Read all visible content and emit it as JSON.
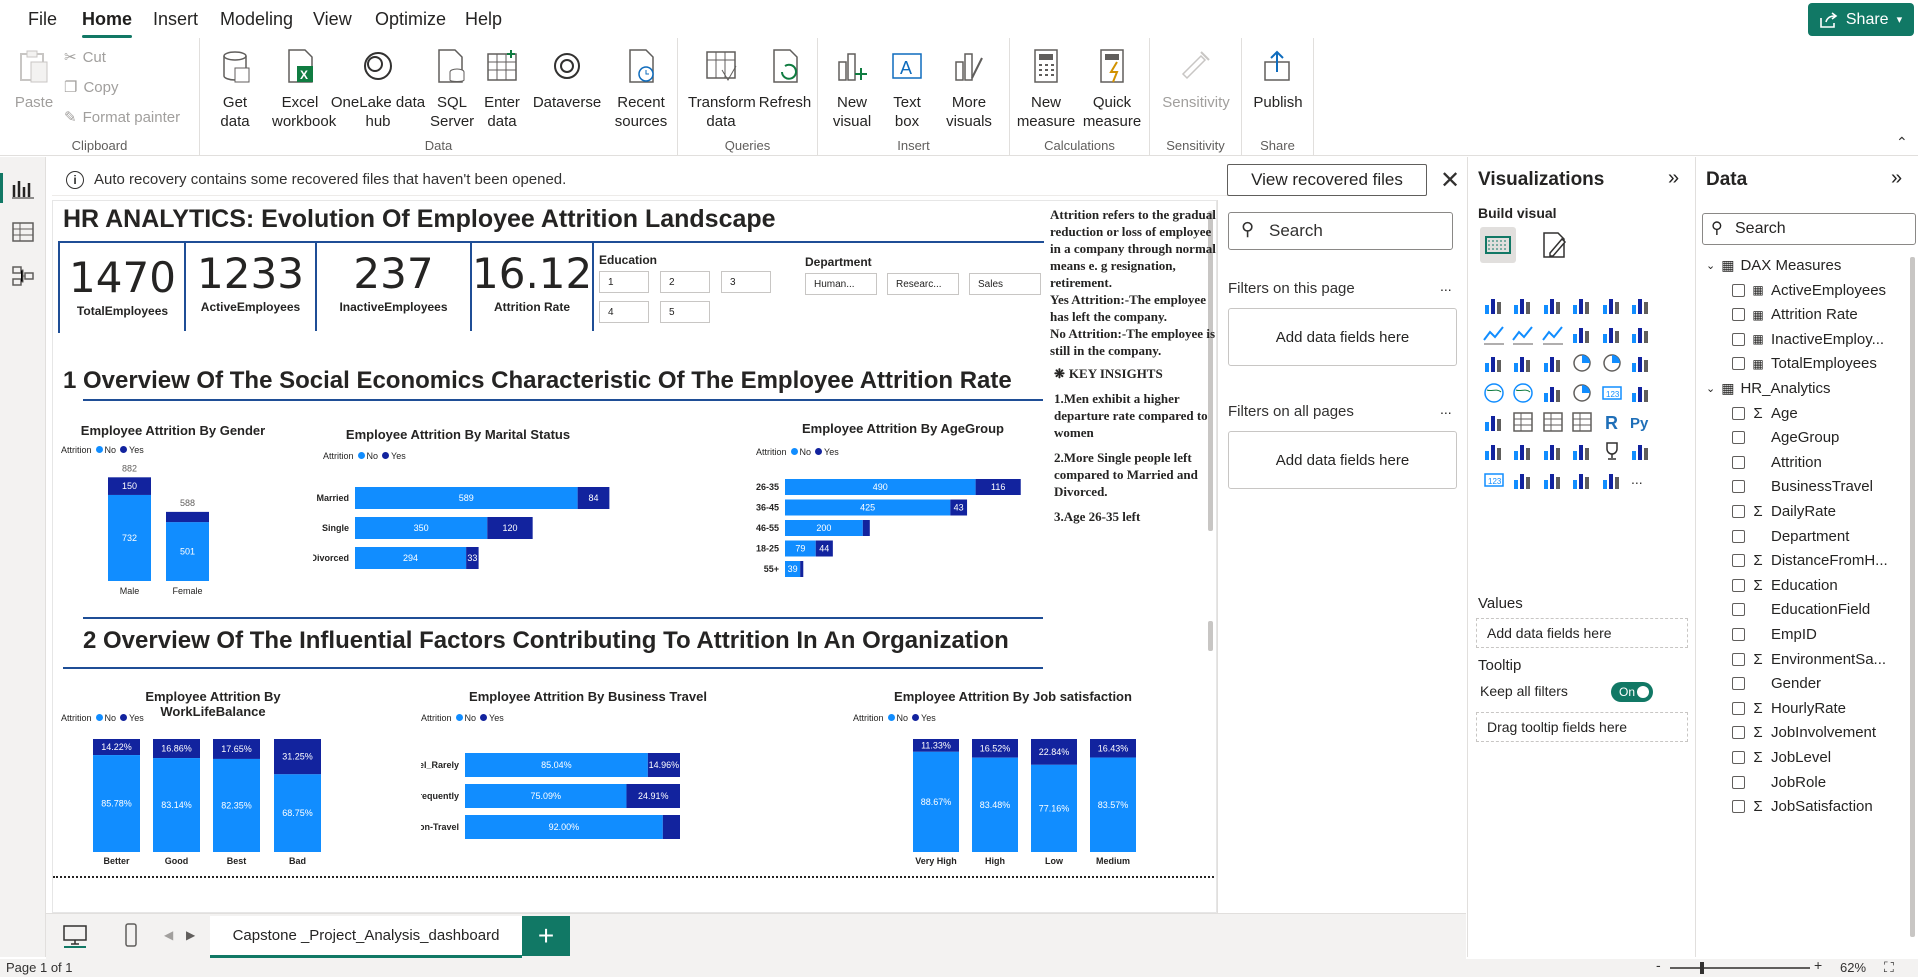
{
  "menu": {
    "file": "File",
    "home": "Home",
    "insert": "Insert",
    "modeling": "Modeling",
    "view": "View",
    "optimize": "Optimize",
    "help": "Help",
    "share": "Share"
  },
  "ribbon": {
    "clipboard": {
      "paste": "Paste",
      "cut": "Cut",
      "copy": "Copy",
      "format_painter": "Format painter",
      "label": "Clipboard"
    },
    "data": {
      "get_data": "Get data",
      "excel": "Excel workbook",
      "onelake": "OneLake data hub",
      "sql": "SQL Server",
      "enter": "Enter data",
      "dataverse": "Dataverse",
      "recent": "Recent sources",
      "label": "Data"
    },
    "queries": {
      "transform": "Transform data",
      "refresh": "Refresh",
      "label": "Queries"
    },
    "insert": {
      "new_visual": "New visual",
      "text_box": "Text box",
      "more_visuals": "More visuals",
      "label": "Insert"
    },
    "calculations": {
      "new_measure": "New measure",
      "quick_measure": "Quick measure",
      "label": "Calculations"
    },
    "sensitivity": {
      "sensitivity": "Sensitivity",
      "label": "Sensitivity"
    },
    "share": {
      "publish": "Publish",
      "label": "Share"
    }
  },
  "notice": {
    "text": "Auto recovery contains some recovered files that haven't been opened.",
    "button": "View recovered files"
  },
  "report": {
    "title": "HR ANALYTICS: Evolution Of Employee Attrition Landscape",
    "kpis": [
      {
        "value": "1470",
        "label": "TotalEmployees"
      },
      {
        "value": "1233",
        "label": "ActiveEmployees"
      },
      {
        "value": "237",
        "label": "InactiveEmployees"
      },
      {
        "value": "16.12",
        "label": "Attrition Rate"
      }
    ],
    "education": {
      "label": "Education",
      "options": [
        "1",
        "2",
        "3",
        "4",
        "5"
      ]
    },
    "department": {
      "label": "Department",
      "options": [
        "Human...",
        "Researc...",
        "Sales"
      ]
    },
    "section1": "1 Overview Of The Social Economics Characteristic Of The Employee Attrition Rate",
    "section2": "2 Overview Of The Influential Factors Contributing To Attrition In An Organization",
    "legend": {
      "title": "Attrition",
      "no": "No",
      "yes": "Yes"
    },
    "side_text": {
      "definition": "Attrition refers to the gradual reduction or loss of employee in a company through normal means e. g resignation, retirement.",
      "yes": "Yes Attrition:-The employee has left the company.",
      "no": "No Attrition:-The employee is still in the company.",
      "insights_title": "KEY INSIGHTS",
      "insight1": "1.Men exhibit a higher departure rate compared to women",
      "insight2": "2.More Single people left compared to Married and Divorced.",
      "insight3": "3.Age 26-35 left"
    }
  },
  "chart_data": [
    {
      "id": "gender",
      "type": "bar",
      "title": "Employee Attrition By Gender",
      "categories": [
        "Male",
        "Female"
      ],
      "series": [
        {
          "name": "No",
          "values": [
            732,
            501
          ]
        },
        {
          "name": "Yes",
          "values": [
            150,
            87
          ]
        }
      ],
      "labels": {
        "no": [
          "732",
          "501"
        ],
        "yes": [
          "150",
          ""
        ]
      },
      "totals": [
        "882",
        "588"
      ],
      "colors": {
        "no": "#118dff",
        "yes": "#12239e"
      }
    },
    {
      "id": "marital",
      "type": "bar",
      "title": "Employee Attrition By Marital Status",
      "categories": [
        "Married",
        "Single",
        "Divorced"
      ],
      "series": [
        {
          "name": "No",
          "values": [
            589,
            350,
            294
          ]
        },
        {
          "name": "Yes",
          "values": [
            84,
            120,
            33
          ]
        }
      ],
      "labels": {
        "no": [
          "589",
          "350",
          "294"
        ],
        "yes": [
          "84",
          "120",
          "33"
        ]
      }
    },
    {
      "id": "age",
      "type": "bar",
      "title": "Employee Attrition By AgeGroup",
      "categories": [
        "26-35",
        "36-45",
        "46-55",
        "18-25",
        "55+"
      ],
      "series": [
        {
          "name": "No",
          "values": [
            490,
            425,
            200,
            79,
            39
          ]
        },
        {
          "name": "Yes",
          "values": [
            116,
            43,
            18,
            44,
            8
          ]
        }
      ],
      "labels": {
        "no": [
          "490",
          "425",
          "200",
          "79",
          "39"
        ],
        "yes": [
          "116",
          "43",
          "",
          "44",
          ""
        ]
      }
    },
    {
      "id": "wlb",
      "type": "bar",
      "title": "Employee Attrition By WorkLifeBalance",
      "categories": [
        "Better",
        "Good",
        "Best",
        "Bad"
      ],
      "series": [
        {
          "name": "No",
          "values": [
            85.78,
            83.14,
            82.35,
            68.75
          ]
        },
        {
          "name": "Yes",
          "values": [
            14.22,
            16.86,
            17.65,
            31.25
          ]
        }
      ],
      "labels": {
        "no": [
          "85.78%",
          "83.14%",
          "82.35%",
          "68.75%"
        ],
        "yes": [
          "14.22%",
          "16.86%",
          "17.65%",
          "31.25%"
        ]
      }
    },
    {
      "id": "travel",
      "type": "bar",
      "title": "Employee Attrition By Business Travel",
      "categories": [
        "Travel_Rarely",
        "Travel_Frequently",
        "Non-Travel"
      ],
      "series": [
        {
          "name": "No",
          "values": [
            85.04,
            75.09,
            92.0
          ]
        },
        {
          "name": "Yes",
          "values": [
            14.96,
            24.91,
            8.0
          ]
        }
      ],
      "labels": {
        "no": [
          "85.04%",
          "75.09%",
          "92.00%"
        ],
        "yes": [
          "14.96%",
          "24.91%",
          ""
        ]
      }
    },
    {
      "id": "jobsat",
      "type": "bar",
      "title": "Employee Attrition By Job satisfaction",
      "categories": [
        "Very High",
        "High",
        "Low",
        "Medium"
      ],
      "series": [
        {
          "name": "No",
          "values": [
            88.67,
            83.48,
            77.16,
            83.57
          ]
        },
        {
          "name": "Yes",
          "values": [
            11.33,
            16.52,
            22.84,
            16.43
          ]
        }
      ],
      "labels": {
        "no": [
          "88.67%",
          "83.48%",
          "77.16%",
          "83.57%"
        ],
        "yes": [
          "11.33%",
          "16.52%",
          "22.84%",
          "16.43%"
        ]
      }
    }
  ],
  "filters": {
    "search": "Search",
    "on_page": "Filters on this page",
    "all_pages": "Filters on all pages",
    "add": "Add data fields here",
    "more": "..."
  },
  "visualizations": {
    "title": "Visualizations",
    "build": "Build visual",
    "values": "Values",
    "values_add": "Add data fields here",
    "tooltip": "Tooltip",
    "keep_filters": "Keep all filters",
    "toggle": "On",
    "tooltip_add": "Drag tooltip fields here",
    "r": "R",
    "py": "Py",
    "more": "..."
  },
  "data_pane": {
    "title": "Data",
    "search": "Search",
    "groups": [
      {
        "name": "DAX Measures",
        "fields": [
          {
            "n": "ActiveEmployees",
            "t": "m"
          },
          {
            "n": "Attrition Rate",
            "t": "m"
          },
          {
            "n": "InactiveEmploy...",
            "t": "m"
          },
          {
            "n": "TotalEmployees",
            "t": "m"
          }
        ]
      },
      {
        "name": "HR_Analytics",
        "fields": [
          {
            "n": "Age",
            "t": "s"
          },
          {
            "n": "AgeGroup",
            "t": ""
          },
          {
            "n": "Attrition",
            "t": ""
          },
          {
            "n": "BusinessTravel",
            "t": ""
          },
          {
            "n": "DailyRate",
            "t": "s"
          },
          {
            "n": "Department",
            "t": ""
          },
          {
            "n": "DistanceFromH...",
            "t": "s"
          },
          {
            "n": "Education",
            "t": "s"
          },
          {
            "n": "EducationField",
            "t": ""
          },
          {
            "n": "EmpID",
            "t": ""
          },
          {
            "n": "EnvironmentSa...",
            "t": "s"
          },
          {
            "n": "Gender",
            "t": ""
          },
          {
            "n": "HourlyRate",
            "t": "s"
          },
          {
            "n": "JobInvolvement",
            "t": "s"
          },
          {
            "n": "JobLevel",
            "t": "s"
          },
          {
            "n": "JobRole",
            "t": ""
          },
          {
            "n": "JobSatisfaction",
            "t": "s"
          }
        ]
      }
    ]
  },
  "tabs": {
    "page": "Capstone _Project_Analysis_dashboard",
    "add": "+"
  },
  "status": {
    "page": "Page 1 of 1",
    "zoom": "62%"
  }
}
